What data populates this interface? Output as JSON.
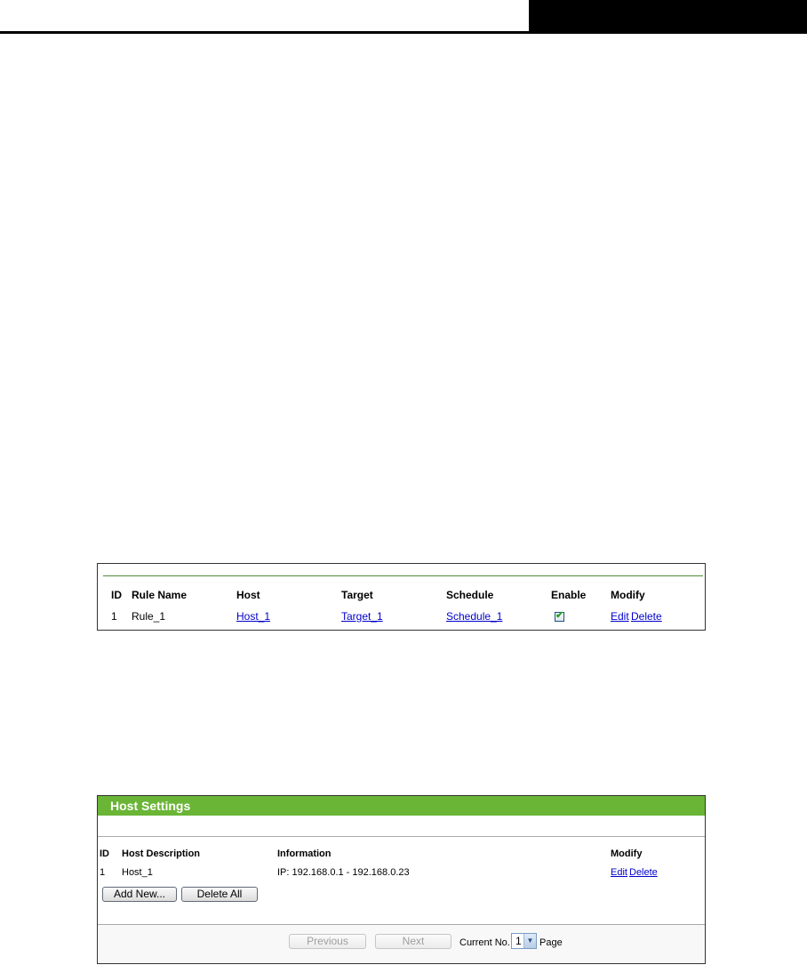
{
  "rule_table": {
    "headers": [
      "ID",
      "Rule Name",
      "Host",
      "Target",
      "Schedule",
      "Enable",
      "Modify"
    ],
    "row": {
      "id": "1",
      "rule_name": "Rule_1",
      "host": "Host_1",
      "target": "Target_1",
      "schedule": "Schedule_1",
      "enabled": true,
      "edit": "Edit",
      "delete": "Delete"
    }
  },
  "host_settings": {
    "title": "Host Settings",
    "headers": [
      "ID",
      "Host Description",
      "Information",
      "Modify"
    ],
    "row": {
      "id": "1",
      "description": "Host_1",
      "information": "IP: 192.168.0.1 - 192.168.0.23",
      "edit": "Edit",
      "delete": "Delete"
    },
    "add_new_label": "Add New...",
    "delete_all_label": "Delete All",
    "previous_label": "Previous",
    "next_label": "Next",
    "current_no_label": "Current No.",
    "page_value": "1",
    "page_label": "Page"
  },
  "colors": {
    "title_bar": "#6ab536",
    "link": "#0000cc",
    "header_bar": "#000000"
  }
}
